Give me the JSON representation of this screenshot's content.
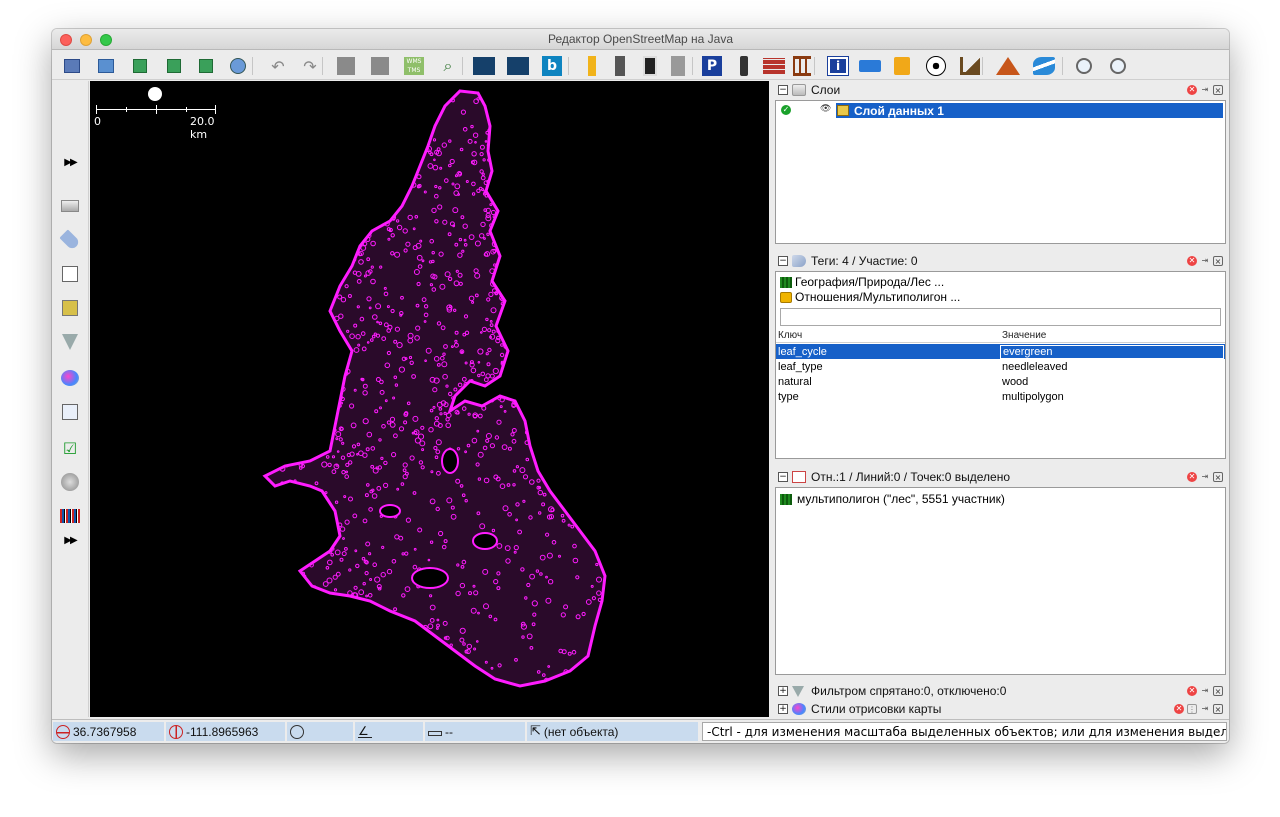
{
  "window": {
    "title": "Редактор OpenStreetMap на Java"
  },
  "toolbar": {
    "buttons": [
      {
        "name": "open-file-icon"
      },
      {
        "name": "open-location-icon"
      },
      {
        "name": "download-icon"
      },
      {
        "name": "download-along-icon"
      },
      {
        "name": "upload-icon"
      },
      {
        "name": "search-location-icon"
      },
      {
        "name": "undo-icon"
      },
      {
        "name": "redo-icon"
      },
      {
        "name": "imagery-1-icon"
      },
      {
        "name": "imagery-2-icon"
      },
      {
        "name": "wms-icon"
      },
      {
        "name": "zoom-imagery-icon"
      },
      {
        "name": "road-preset-1-icon"
      },
      {
        "name": "road-preset-2-icon"
      },
      {
        "name": "bing-icon"
      },
      {
        "name": "railway-1-icon"
      },
      {
        "name": "railway-2-icon"
      },
      {
        "name": "railway-3-icon"
      },
      {
        "name": "railway-4-icon"
      },
      {
        "name": "parking-icon"
      },
      {
        "name": "traffic-signals-icon"
      },
      {
        "name": "wall-icon"
      },
      {
        "name": "fence-icon"
      },
      {
        "name": "info-icon"
      },
      {
        "name": "hotel-icon"
      },
      {
        "name": "shop-icon"
      },
      {
        "name": "football-icon"
      },
      {
        "name": "industrial-icon"
      },
      {
        "name": "peak-icon"
      },
      {
        "name": "river-icon"
      },
      {
        "name": "zoom-in-icon"
      },
      {
        "name": "zoom-out-icon"
      }
    ],
    "wms_label": "WMS TMS",
    "bing_label": "b",
    "parking_label": "P",
    "info_label": "i"
  },
  "left_tools": [
    {
      "name": "select-tool-icon"
    },
    {
      "name": "draw-tool-icon"
    },
    {
      "name": "more-tools-icon",
      "label": "▸▸"
    },
    {
      "name": "layers-icon"
    },
    {
      "name": "tags-icon"
    },
    {
      "name": "selection-list-icon"
    },
    {
      "name": "imagery-icon"
    },
    {
      "name": "filter-icon"
    },
    {
      "name": "map-styles-icon"
    },
    {
      "name": "history-icon"
    },
    {
      "name": "validation-icon"
    },
    {
      "name": "globe-icon"
    },
    {
      "name": "barcode-icon"
    },
    {
      "name": "more-dialogs-icon",
      "label": "▸▸"
    }
  ],
  "map": {
    "scale_start": "0",
    "scale_end": "20.0 km",
    "polygon_color": "#ff1cff",
    "fill_color": "#2a0a2a"
  },
  "layers_panel": {
    "title": "Слои",
    "layer_name": "Слой данных 1"
  },
  "tags_panel": {
    "title": "Теги: 4 / Участие: 0",
    "preset_1": "География/Природа/Лес ...",
    "preset_2": "Отношения/Мультиполигон ...",
    "search_value": "",
    "header_key": "Ключ",
    "header_value": "Значение",
    "rows": [
      {
        "key": "leaf_cycle",
        "value": "evergreen"
      },
      {
        "key": "leaf_type",
        "value": "needleleaved"
      },
      {
        "key": "natural",
        "value": "wood"
      },
      {
        "key": "type",
        "value": "multipolygon"
      }
    ]
  },
  "selection_panel": {
    "title": "Отн.:1 / Линий:0 / Точек:0 выделено",
    "item": "мультиполигон (\"лес\", 5551 участник)"
  },
  "filter_panel": {
    "title": "Фильтром спрятано:0, отключено:0"
  },
  "styles_panel": {
    "title": "Стили отрисовки карты"
  },
  "status": {
    "lat": "36.7367958",
    "lon": "-111.8965963",
    "heading": "",
    "angle": "",
    "distance": "--",
    "object": "(нет объекта)",
    "help": "-Ctrl - для изменения масштаба выделенных объектов; или для изменения выделения"
  }
}
